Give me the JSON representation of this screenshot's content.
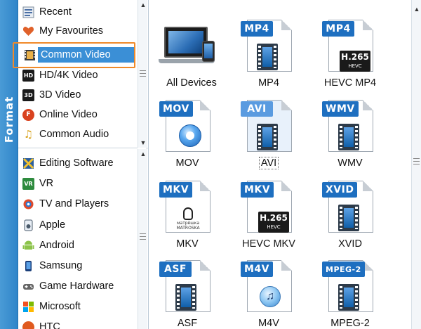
{
  "format_strip": {
    "label": "Format"
  },
  "categories_top": [
    {
      "label": "Recent",
      "icon": "recent-icon"
    },
    {
      "label": "My Favourites",
      "icon": "heart-icon"
    },
    {
      "label": "Common Video",
      "icon": "film-icon",
      "selected": true
    },
    {
      "label": "HD/4K Video",
      "icon": "hd-icon"
    },
    {
      "label": "3D Video",
      "icon": "3d-icon"
    },
    {
      "label": "Online Video",
      "icon": "online-icon"
    },
    {
      "label": "Common Audio",
      "icon": "music-note-icon"
    }
  ],
  "categories_bottom": [
    {
      "label": "Editing Software",
      "icon": "editing-icon"
    },
    {
      "label": "VR",
      "icon": "vr-icon"
    },
    {
      "label": "TV and Players",
      "icon": "tv-icon"
    },
    {
      "label": "Apple",
      "icon": "apple-icon"
    },
    {
      "label": "Android",
      "icon": "android-icon"
    },
    {
      "label": "Samsung",
      "icon": "samsung-icon"
    },
    {
      "label": "Game Hardware",
      "icon": "gamepad-icon"
    },
    {
      "label": "Microsoft",
      "icon": "windows-icon"
    },
    {
      "label": "HTC",
      "icon": "htc-icon"
    }
  ],
  "formats": [
    {
      "label": "All Devices",
      "badge": ""
    },
    {
      "label": "MP4",
      "badge": "MP4"
    },
    {
      "label": "HEVC MP4",
      "badge": "MP4",
      "sub": "H.265",
      "sub2": "HEVC"
    },
    {
      "label": "MOV",
      "badge": "MOV"
    },
    {
      "label": "AVI",
      "badge": "AVI",
      "selected": true
    },
    {
      "label": "WMV",
      "badge": "WMV"
    },
    {
      "label": "MKV",
      "badge": "MKV",
      "sub": "матрёшка",
      "sub2": "MATROSKA"
    },
    {
      "label": "HEVC MKV",
      "badge": "MKV",
      "sub": "H.265",
      "sub2": "HEVC"
    },
    {
      "label": "XVID",
      "badge": "XVID"
    },
    {
      "label": "ASF",
      "badge": "ASF"
    },
    {
      "label": "M4V",
      "badge": "M4V"
    },
    {
      "label": "MPEG-2",
      "badge": "MPEG-2"
    }
  ],
  "colors": {
    "accent_blue": "#1e6fc0",
    "selection_blue": "#3b8fd6",
    "highlight_orange": "#f08a2a",
    "strip_blue": "#2f85c9"
  }
}
